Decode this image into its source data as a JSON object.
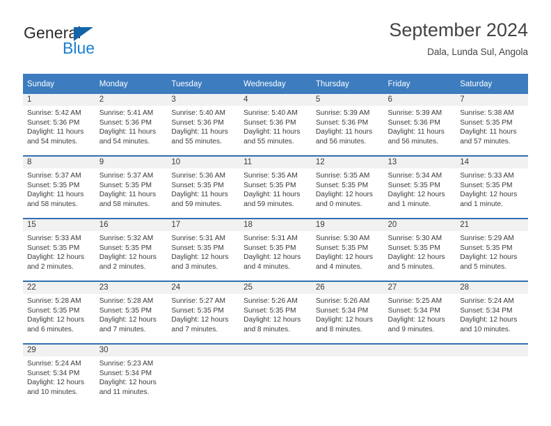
{
  "logo": {
    "word1": "General",
    "word2": "Blue",
    "triangle_color": "#1464aa",
    "blue_color": "#1a7fd4"
  },
  "header": {
    "title": "September 2024",
    "location": "Dala, Lunda Sul, Angola"
  },
  "theme": {
    "header_bg": "#3c7cbf",
    "divider": "#2f6fb0",
    "daynum_bg": "#f1f1f1",
    "text": "#3a3a3a"
  },
  "weekdays": [
    "Sunday",
    "Monday",
    "Tuesday",
    "Wednesday",
    "Thursday",
    "Friday",
    "Saturday"
  ],
  "weeks": [
    [
      {
        "day": "1",
        "sunrise": "Sunrise: 5:42 AM",
        "sunset": "Sunset: 5:36 PM",
        "daylight1": "Daylight: 11 hours",
        "daylight2": "and 54 minutes."
      },
      {
        "day": "2",
        "sunrise": "Sunrise: 5:41 AM",
        "sunset": "Sunset: 5:36 PM",
        "daylight1": "Daylight: 11 hours",
        "daylight2": "and 54 minutes."
      },
      {
        "day": "3",
        "sunrise": "Sunrise: 5:40 AM",
        "sunset": "Sunset: 5:36 PM",
        "daylight1": "Daylight: 11 hours",
        "daylight2": "and 55 minutes."
      },
      {
        "day": "4",
        "sunrise": "Sunrise: 5:40 AM",
        "sunset": "Sunset: 5:36 PM",
        "daylight1": "Daylight: 11 hours",
        "daylight2": "and 55 minutes."
      },
      {
        "day": "5",
        "sunrise": "Sunrise: 5:39 AM",
        "sunset": "Sunset: 5:36 PM",
        "daylight1": "Daylight: 11 hours",
        "daylight2": "and 56 minutes."
      },
      {
        "day": "6",
        "sunrise": "Sunrise: 5:39 AM",
        "sunset": "Sunset: 5:36 PM",
        "daylight1": "Daylight: 11 hours",
        "daylight2": "and 56 minutes."
      },
      {
        "day": "7",
        "sunrise": "Sunrise: 5:38 AM",
        "sunset": "Sunset: 5:35 PM",
        "daylight1": "Daylight: 11 hours",
        "daylight2": "and 57 minutes."
      }
    ],
    [
      {
        "day": "8",
        "sunrise": "Sunrise: 5:37 AM",
        "sunset": "Sunset: 5:35 PM",
        "daylight1": "Daylight: 11 hours",
        "daylight2": "and 58 minutes."
      },
      {
        "day": "9",
        "sunrise": "Sunrise: 5:37 AM",
        "sunset": "Sunset: 5:35 PM",
        "daylight1": "Daylight: 11 hours",
        "daylight2": "and 58 minutes."
      },
      {
        "day": "10",
        "sunrise": "Sunrise: 5:36 AM",
        "sunset": "Sunset: 5:35 PM",
        "daylight1": "Daylight: 11 hours",
        "daylight2": "and 59 minutes."
      },
      {
        "day": "11",
        "sunrise": "Sunrise: 5:35 AM",
        "sunset": "Sunset: 5:35 PM",
        "daylight1": "Daylight: 11 hours",
        "daylight2": "and 59 minutes."
      },
      {
        "day": "12",
        "sunrise": "Sunrise: 5:35 AM",
        "sunset": "Sunset: 5:35 PM",
        "daylight1": "Daylight: 12 hours",
        "daylight2": "and 0 minutes."
      },
      {
        "day": "13",
        "sunrise": "Sunrise: 5:34 AM",
        "sunset": "Sunset: 5:35 PM",
        "daylight1": "Daylight: 12 hours",
        "daylight2": "and 1 minute."
      },
      {
        "day": "14",
        "sunrise": "Sunrise: 5:33 AM",
        "sunset": "Sunset: 5:35 PM",
        "daylight1": "Daylight: 12 hours",
        "daylight2": "and 1 minute."
      }
    ],
    [
      {
        "day": "15",
        "sunrise": "Sunrise: 5:33 AM",
        "sunset": "Sunset: 5:35 PM",
        "daylight1": "Daylight: 12 hours",
        "daylight2": "and 2 minutes."
      },
      {
        "day": "16",
        "sunrise": "Sunrise: 5:32 AM",
        "sunset": "Sunset: 5:35 PM",
        "daylight1": "Daylight: 12 hours",
        "daylight2": "and 2 minutes."
      },
      {
        "day": "17",
        "sunrise": "Sunrise: 5:31 AM",
        "sunset": "Sunset: 5:35 PM",
        "daylight1": "Daylight: 12 hours",
        "daylight2": "and 3 minutes."
      },
      {
        "day": "18",
        "sunrise": "Sunrise: 5:31 AM",
        "sunset": "Sunset: 5:35 PM",
        "daylight1": "Daylight: 12 hours",
        "daylight2": "and 4 minutes."
      },
      {
        "day": "19",
        "sunrise": "Sunrise: 5:30 AM",
        "sunset": "Sunset: 5:35 PM",
        "daylight1": "Daylight: 12 hours",
        "daylight2": "and 4 minutes."
      },
      {
        "day": "20",
        "sunrise": "Sunrise: 5:30 AM",
        "sunset": "Sunset: 5:35 PM",
        "daylight1": "Daylight: 12 hours",
        "daylight2": "and 5 minutes."
      },
      {
        "day": "21",
        "sunrise": "Sunrise: 5:29 AM",
        "sunset": "Sunset: 5:35 PM",
        "daylight1": "Daylight: 12 hours",
        "daylight2": "and 5 minutes."
      }
    ],
    [
      {
        "day": "22",
        "sunrise": "Sunrise: 5:28 AM",
        "sunset": "Sunset: 5:35 PM",
        "daylight1": "Daylight: 12 hours",
        "daylight2": "and 6 minutes."
      },
      {
        "day": "23",
        "sunrise": "Sunrise: 5:28 AM",
        "sunset": "Sunset: 5:35 PM",
        "daylight1": "Daylight: 12 hours",
        "daylight2": "and 7 minutes."
      },
      {
        "day": "24",
        "sunrise": "Sunrise: 5:27 AM",
        "sunset": "Sunset: 5:35 PM",
        "daylight1": "Daylight: 12 hours",
        "daylight2": "and 7 minutes."
      },
      {
        "day": "25",
        "sunrise": "Sunrise: 5:26 AM",
        "sunset": "Sunset: 5:35 PM",
        "daylight1": "Daylight: 12 hours",
        "daylight2": "and 8 minutes."
      },
      {
        "day": "26",
        "sunrise": "Sunrise: 5:26 AM",
        "sunset": "Sunset: 5:34 PM",
        "daylight1": "Daylight: 12 hours",
        "daylight2": "and 8 minutes."
      },
      {
        "day": "27",
        "sunrise": "Sunrise: 5:25 AM",
        "sunset": "Sunset: 5:34 PM",
        "daylight1": "Daylight: 12 hours",
        "daylight2": "and 9 minutes."
      },
      {
        "day": "28",
        "sunrise": "Sunrise: 5:24 AM",
        "sunset": "Sunset: 5:34 PM",
        "daylight1": "Daylight: 12 hours",
        "daylight2": "and 10 minutes."
      }
    ],
    [
      {
        "day": "29",
        "sunrise": "Sunrise: 5:24 AM",
        "sunset": "Sunset: 5:34 PM",
        "daylight1": "Daylight: 12 hours",
        "daylight2": "and 10 minutes."
      },
      {
        "day": "30",
        "sunrise": "Sunrise: 5:23 AM",
        "sunset": "Sunset: 5:34 PM",
        "daylight1": "Daylight: 12 hours",
        "daylight2": "and 11 minutes."
      },
      {
        "day": "",
        "sunrise": "",
        "sunset": "",
        "daylight1": "",
        "daylight2": ""
      },
      {
        "day": "",
        "sunrise": "",
        "sunset": "",
        "daylight1": "",
        "daylight2": ""
      },
      {
        "day": "",
        "sunrise": "",
        "sunset": "",
        "daylight1": "",
        "daylight2": ""
      },
      {
        "day": "",
        "sunrise": "",
        "sunset": "",
        "daylight1": "",
        "daylight2": ""
      },
      {
        "day": "",
        "sunrise": "",
        "sunset": "",
        "daylight1": "",
        "daylight2": ""
      }
    ]
  ]
}
